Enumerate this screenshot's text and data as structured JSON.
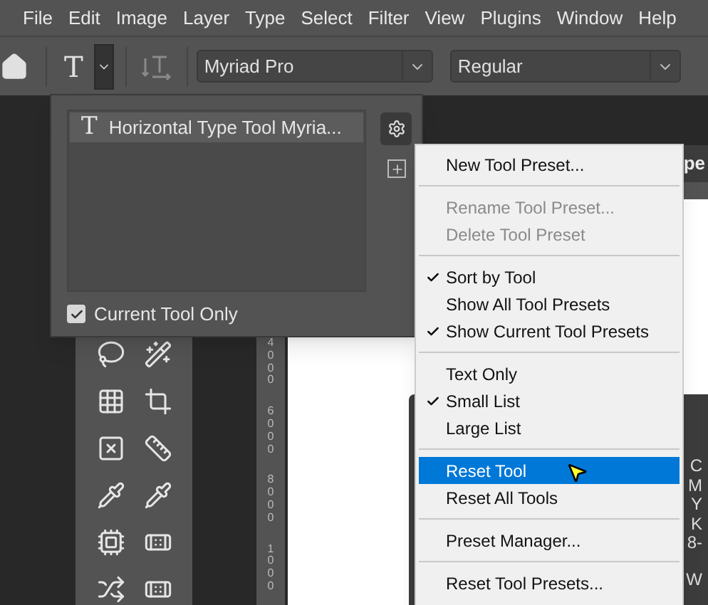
{
  "menubar": [
    "File",
    "Edit",
    "Image",
    "Layer",
    "Type",
    "Select",
    "Filter",
    "View",
    "Plugins",
    "Window",
    "Help"
  ],
  "options_bar": {
    "tool_glyph": "T",
    "font_family": "Myriad Pro",
    "font_style": "Regular"
  },
  "preset_panel": {
    "items": [
      {
        "glyph": "T",
        "label": "Horizontal Type Tool Myria...",
        "selected": true
      }
    ],
    "current_tool_only": {
      "label": "Current Tool Only",
      "checked": true
    }
  },
  "preset_menu": {
    "groups": [
      [
        {
          "label": "New Tool Preset...",
          "checked": false,
          "disabled": false,
          "selected": false
        }
      ],
      [
        {
          "label": "Rename Tool Preset...",
          "checked": false,
          "disabled": true,
          "selected": false
        },
        {
          "label": "Delete Tool Preset",
          "checked": false,
          "disabled": true,
          "selected": false
        }
      ],
      [
        {
          "label": "Sort by Tool",
          "checked": true,
          "disabled": false,
          "selected": false
        },
        {
          "label": "Show All Tool Presets",
          "checked": false,
          "disabled": false,
          "selected": false
        },
        {
          "label": "Show Current Tool Presets",
          "checked": true,
          "disabled": false,
          "selected": false
        }
      ],
      [
        {
          "label": "Text Only",
          "checked": false,
          "disabled": false,
          "selected": false
        },
        {
          "label": "Small List",
          "checked": true,
          "disabled": false,
          "selected": false
        },
        {
          "label": "Large List",
          "checked": false,
          "disabled": false,
          "selected": false
        }
      ],
      [
        {
          "label": "Reset Tool",
          "checked": false,
          "disabled": false,
          "selected": true
        },
        {
          "label": "Reset All Tools",
          "checked": false,
          "disabled": false,
          "selected": false
        }
      ],
      [
        {
          "label": "Preset Manager...",
          "checked": false,
          "disabled": false,
          "selected": false
        }
      ],
      [
        {
          "label": "Reset Tool Presets...",
          "checked": false,
          "disabled": false,
          "selected": false
        }
      ]
    ]
  },
  "ruler": {
    "labels": [
      "4000",
      "6000",
      "8000",
      "1000"
    ]
  },
  "document": {
    "tab_fragment": "pe"
  },
  "info_panel": {
    "lines": [
      "C",
      "M",
      "Y",
      "K",
      "8-"
    ],
    "footer": "W"
  }
}
